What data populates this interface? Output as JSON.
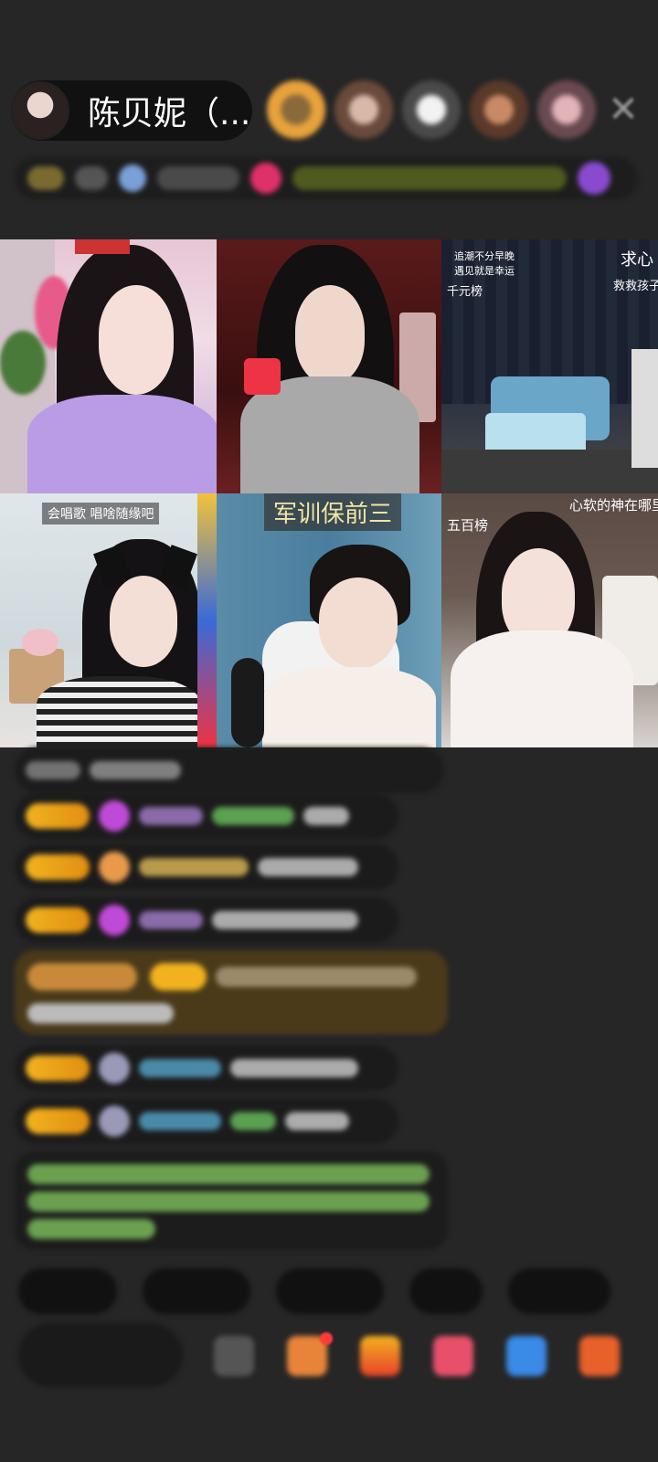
{
  "header": {
    "host_name": "陈贝妮（...",
    "close_icon": "close-icon"
  },
  "viewers": [
    {
      "color": "#e8a23c"
    },
    {
      "color": "#b58a78"
    },
    {
      "color": "#d7d7d7"
    },
    {
      "color": "#c78a64"
    },
    {
      "color": "#e2b3b9"
    }
  ],
  "video_grid": {
    "cells": [
      {
        "caption": "",
        "banner": ""
      },
      {
        "caption": "",
        "banner": ""
      },
      {
        "caption_lines": [
          "追潮不分早晚",
          "遇见就是幸运",
          "千元榜"
        ],
        "side_text": "求心",
        "side_text2": "救救孩子"
      },
      {
        "caption": "会唱歌   唱啥随缘吧"
      },
      {
        "banner": "军训保前三"
      },
      {
        "caption_lines": [
          "五百榜"
        ],
        "side_text": "心软的神在哪里"
      }
    ]
  },
  "colors": {
    "accent_gold": "#f2b21f",
    "background": "#262626"
  }
}
